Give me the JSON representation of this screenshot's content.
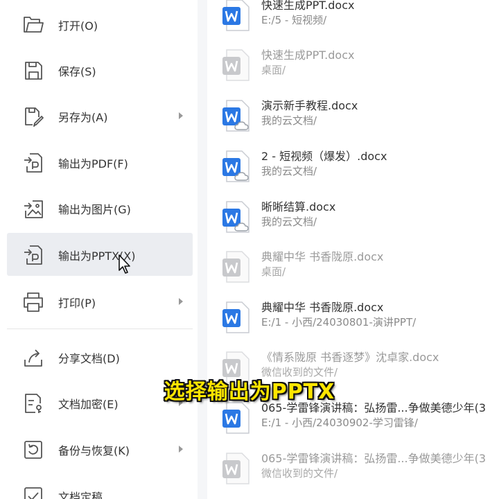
{
  "menu": {
    "items": [
      {
        "label": "打开(O)",
        "icon": "folder-open-icon"
      },
      {
        "label": "保存(S)",
        "icon": "save-icon"
      },
      {
        "label": "另存为(A)",
        "icon": "save-as-icon",
        "submenu": true
      },
      {
        "label": "输出为PDF(F)",
        "icon": "export-pdf-icon"
      },
      {
        "label": "输出为图片(G)",
        "icon": "export-image-icon"
      },
      {
        "label": "输出为PPTX(X)",
        "icon": "export-pptx-icon",
        "highlighted": true
      },
      {
        "label": "打印(P)",
        "icon": "printer-icon",
        "submenu": true
      },
      {
        "label": "分享文档(D)",
        "icon": "share-icon"
      },
      {
        "label": "文档加密(E)",
        "icon": "encrypt-icon",
        "submenu": true
      },
      {
        "label": "备份与恢复(K)",
        "icon": "backup-restore-icon",
        "submenu": true
      },
      {
        "label": "文档定稿",
        "icon": "finalize-icon"
      }
    ]
  },
  "recent_files": [
    {
      "name": "快速生成PPT.docx",
      "path": "E:/5 - 短视频/",
      "style": "word"
    },
    {
      "name": "快速生成PPT.docx",
      "path": "桌面/",
      "style": "missing"
    },
    {
      "name": "演示新手教程.docx",
      "path": "我的云文档/",
      "style": "cloud"
    },
    {
      "name": "2 - 短视频（爆发）.docx",
      "path": "我的云文档/",
      "style": "cloud"
    },
    {
      "name": "晰晰结算.docx",
      "path": "我的云文档/",
      "style": "cloud"
    },
    {
      "name": "典耀中华 书香陇原.docx",
      "path": "桌面/",
      "style": "missing"
    },
    {
      "name": "典耀中华 书香陇原.docx",
      "path": "E:/1 - 小西/24030801-演讲PPT/",
      "style": "word"
    },
    {
      "name": "《情系陇原 书香逐梦》沈卓家.docx",
      "path": "微信收到的文件/",
      "style": "missing"
    },
    {
      "name": "065-学雷锋演讲稿：弘扬雷...争做美德少年(3",
      "path": "E:/1 - 小西/24030902-学习雷锋/",
      "style": "word"
    },
    {
      "name": "065-学雷锋演讲稿：弘扬雷...争做美德少年(3",
      "path": "微信收到的文件/",
      "style": "missing"
    }
  ],
  "caption": "选择输出为PPTX",
  "colors": {
    "word_blue": "#2b78e4",
    "highlight_bg": "#ebedf1",
    "caption_yellow": "#ffe600"
  }
}
